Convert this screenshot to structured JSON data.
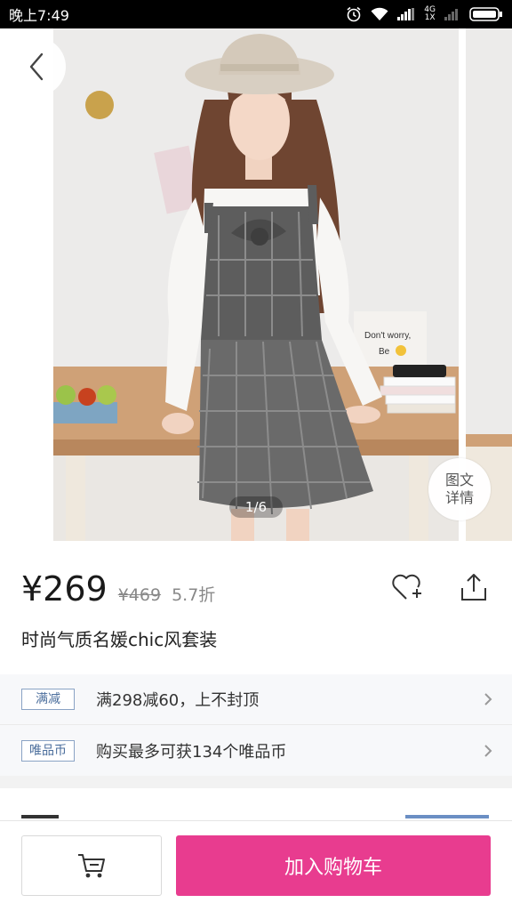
{
  "status_bar": {
    "time": "晚上7:49",
    "network_top": "4G",
    "network_bottom": "1X",
    "icons": [
      "alarm-icon",
      "wifi-icon",
      "signal-icon",
      "battery-icon"
    ]
  },
  "gallery": {
    "page_indicator": "1/6",
    "detail_button_line1": "图文",
    "detail_button_line2": "详情",
    "photo_props": {
      "sign_line1": "Don't worry,",
      "sign_line2": "Be"
    }
  },
  "product": {
    "price": "¥269",
    "original_price": "¥469",
    "discount": "5.7折",
    "title": "时尚气质名媛chic风套装"
  },
  "promotions": [
    {
      "tag": "满减",
      "text": "满298减60，上不封顶"
    },
    {
      "tag": "唯品币",
      "text": "购买最多可获134个唯品币"
    }
  ],
  "bottom_bar": {
    "add_to_cart_label": "加入购物车"
  },
  "colors": {
    "accent_pink": "#e83c8f",
    "tag_blue": "#4b6e9c",
    "link_blue": "#6b8fc4"
  }
}
